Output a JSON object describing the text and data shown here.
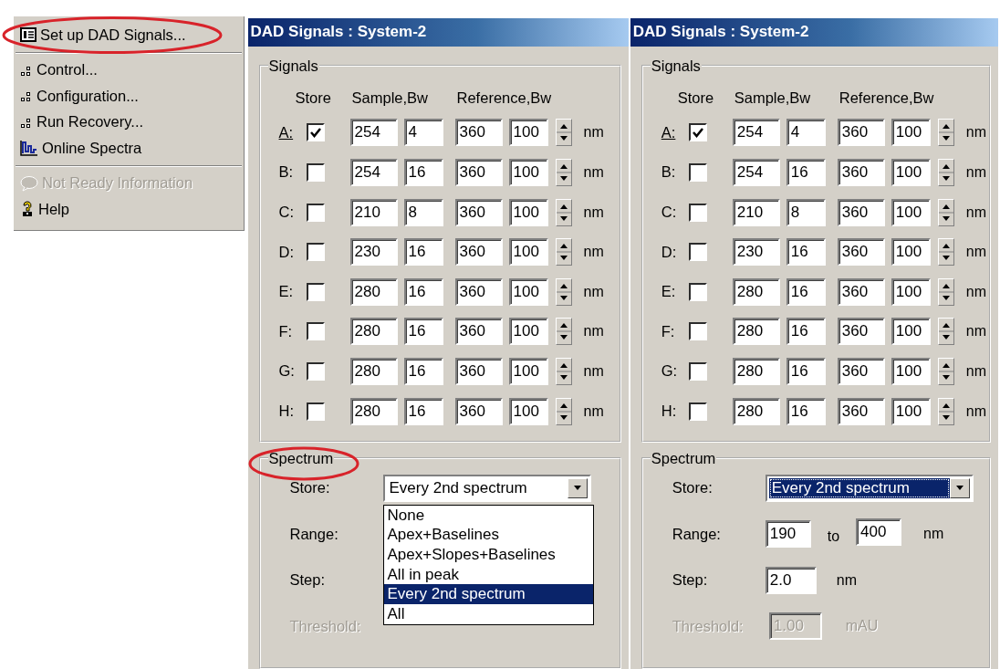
{
  "menu": {
    "items": [
      {
        "kind": "item",
        "label": "Set up DAD Signals...",
        "disabled": false,
        "circled": true
      },
      {
        "kind": "separator"
      },
      {
        "kind": "item",
        "label": "Control...",
        "disabled": false
      },
      {
        "kind": "item",
        "label": "Configuration...",
        "disabled": false
      },
      {
        "kind": "item",
        "label": "Run Recovery...",
        "disabled": false
      },
      {
        "kind": "item",
        "label": "Online Spectra",
        "disabled": false
      },
      {
        "kind": "separator"
      },
      {
        "kind": "item",
        "label": "Not Ready Information",
        "disabled": true
      },
      {
        "kind": "item",
        "label": "Help",
        "disabled": false
      }
    ]
  },
  "dialogs": [
    {
      "title": "DAD Signals : System-2",
      "signals": {
        "title": "Signals",
        "headers": [
          "Store",
          "Sample,Bw",
          "Reference,Bw"
        ],
        "rows": [
          {
            "letter": "A:",
            "accelerator": true,
            "store": true,
            "sample": "254",
            "sample_bw": "4",
            "reference": "360",
            "reference_bw": "100",
            "unit": "nm"
          },
          {
            "letter": "B:",
            "accelerator": false,
            "store": false,
            "sample": "254",
            "sample_bw": "16",
            "reference": "360",
            "reference_bw": "100",
            "unit": "nm"
          },
          {
            "letter": "C:",
            "accelerator": false,
            "store": false,
            "sample": "210",
            "sample_bw": "8",
            "reference": "360",
            "reference_bw": "100",
            "unit": "nm"
          },
          {
            "letter": "D:",
            "accelerator": false,
            "store": false,
            "sample": "230",
            "sample_bw": "16",
            "reference": "360",
            "reference_bw": "100",
            "unit": "nm"
          },
          {
            "letter": "E:",
            "accelerator": false,
            "store": false,
            "sample": "280",
            "sample_bw": "16",
            "reference": "360",
            "reference_bw": "100",
            "unit": "nm"
          },
          {
            "letter": "F:",
            "accelerator": false,
            "store": false,
            "sample": "280",
            "sample_bw": "16",
            "reference": "360",
            "reference_bw": "100",
            "unit": "nm"
          },
          {
            "letter": "G:",
            "accelerator": false,
            "store": false,
            "sample": "280",
            "sample_bw": "16",
            "reference": "360",
            "reference_bw": "100",
            "unit": "nm"
          },
          {
            "letter": "H:",
            "accelerator": false,
            "store": false,
            "sample": "280",
            "sample_bw": "16",
            "reference": "360",
            "reference_bw": "100",
            "unit": "nm"
          }
        ]
      },
      "spectrum": {
        "title": "Spectrum",
        "circled": true,
        "store_label": "Store:",
        "store_value": "Every 2nd spectrum",
        "focused": false,
        "options": [
          {
            "label": "None",
            "selected": false
          },
          {
            "label": "Apex+Baselines",
            "selected": false
          },
          {
            "label": "Apex+Slopes+Baselines",
            "selected": false
          },
          {
            "label": "All in peak",
            "selected": false
          },
          {
            "label": "Every 2nd spectrum",
            "selected": true
          },
          {
            "label": "All",
            "selected": false
          }
        ],
        "range_label": "Range:",
        "step_label": "Step:",
        "threshold_label": "Threshold:",
        "threshold_disabled": true
      }
    },
    {
      "title": "DAD Signals : System-2",
      "signals": {
        "title": "Signals",
        "headers": [
          "Store",
          "Sample,Bw",
          "Reference,Bw"
        ],
        "rows": [
          {
            "letter": "A:",
            "accelerator": true,
            "store": true,
            "sample": "254",
            "sample_bw": "4",
            "reference": "360",
            "reference_bw": "100",
            "unit": "nm"
          },
          {
            "letter": "B:",
            "accelerator": false,
            "store": false,
            "sample": "254",
            "sample_bw": "16",
            "reference": "360",
            "reference_bw": "100",
            "unit": "nm"
          },
          {
            "letter": "C:",
            "accelerator": false,
            "store": false,
            "sample": "210",
            "sample_bw": "8",
            "reference": "360",
            "reference_bw": "100",
            "unit": "nm"
          },
          {
            "letter": "D:",
            "accelerator": false,
            "store": false,
            "sample": "230",
            "sample_bw": "16",
            "reference": "360",
            "reference_bw": "100",
            "unit": "nm"
          },
          {
            "letter": "E:",
            "accelerator": false,
            "store": false,
            "sample": "280",
            "sample_bw": "16",
            "reference": "360",
            "reference_bw": "100",
            "unit": "nm"
          },
          {
            "letter": "F:",
            "accelerator": false,
            "store": false,
            "sample": "280",
            "sample_bw": "16",
            "reference": "360",
            "reference_bw": "100",
            "unit": "nm"
          },
          {
            "letter": "G:",
            "accelerator": false,
            "store": false,
            "sample": "280",
            "sample_bw": "16",
            "reference": "360",
            "reference_bw": "100",
            "unit": "nm"
          },
          {
            "letter": "H:",
            "accelerator": false,
            "store": false,
            "sample": "280",
            "sample_bw": "16",
            "reference": "360",
            "reference_bw": "100",
            "unit": "nm"
          }
        ]
      },
      "spectrum": {
        "title": "Spectrum",
        "store_label": "Store:",
        "store_value": "Every 2nd spectrum",
        "focused": true,
        "range_label": "Range:",
        "range_from": "190",
        "range_to_label": "to",
        "range_to": "400",
        "range_unit": "nm",
        "step_label": "Step:",
        "step_value": "2.0",
        "step_unit": "nm",
        "threshold_label": "Threshold:",
        "threshold_value": "1.00",
        "threshold_unit": "mAU",
        "threshold_disabled": true
      }
    }
  ]
}
